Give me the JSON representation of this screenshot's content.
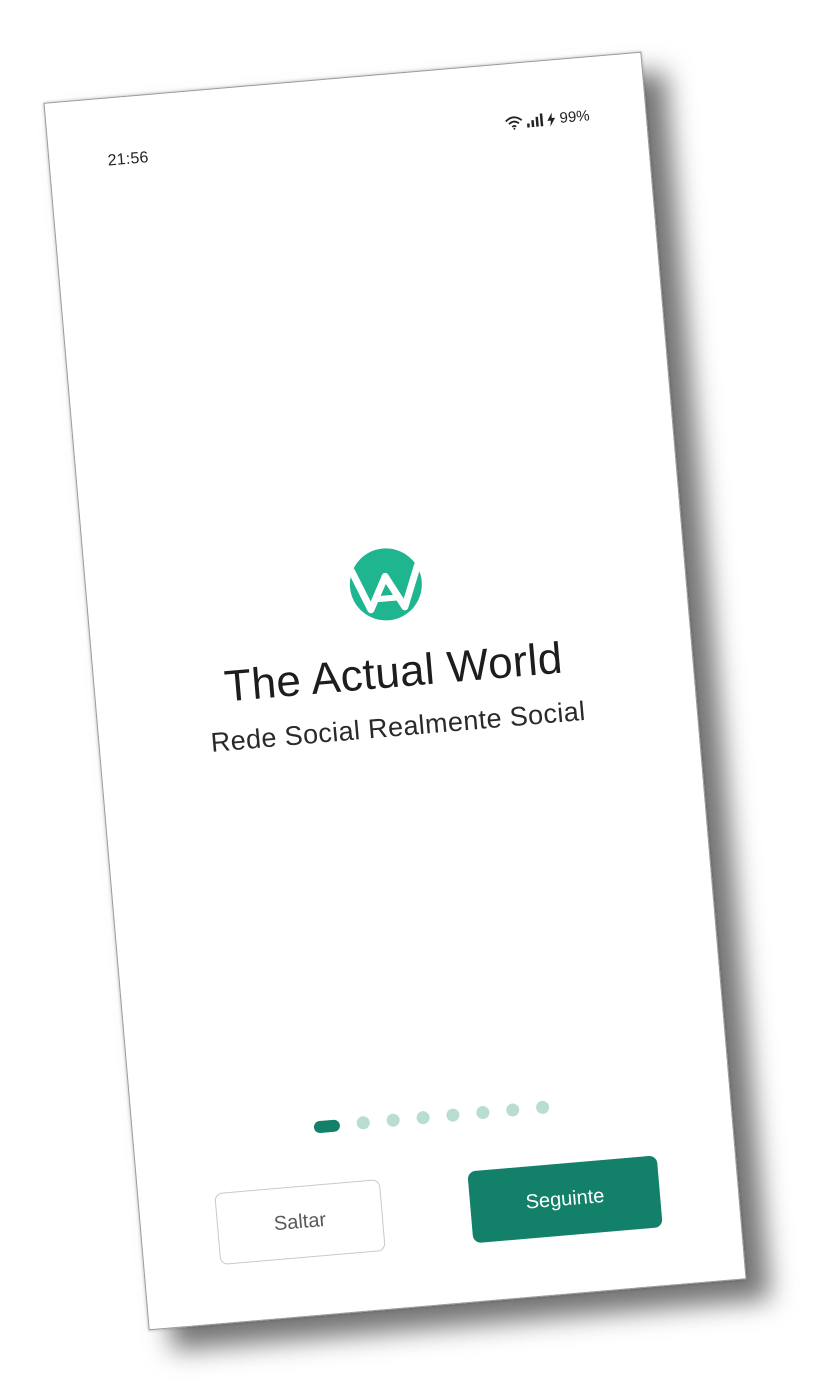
{
  "status_bar": {
    "time": "21:56",
    "battery": "99%",
    "icons": [
      "wifi-icon",
      "signal-icon",
      "charging-icon"
    ]
  },
  "splash": {
    "logo": "actual-world-logo",
    "title": "The Actual World",
    "subtitle": "Rede Social Realmente Social"
  },
  "pager": {
    "total": 8,
    "active_index": 0
  },
  "actions": {
    "skip_label": "Saltar",
    "next_label": "Seguinte"
  },
  "colors": {
    "accent": "#13806a",
    "logo": "#1fb58e",
    "dot_inactive": "#b9ddd2"
  }
}
